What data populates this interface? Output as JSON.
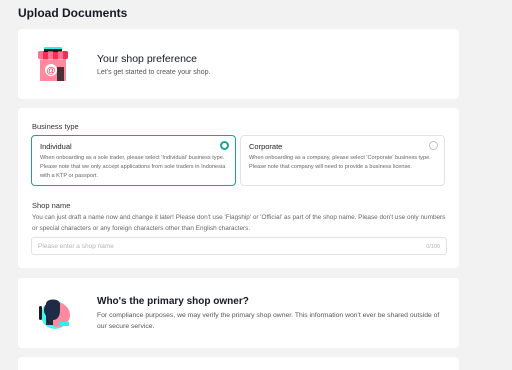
{
  "page": {
    "title": "Upload Documents"
  },
  "shop_preference": {
    "title": "Your shop preference",
    "subtitle": "Let's get started to create your shop."
  },
  "business_type": {
    "label": "Business type",
    "options": [
      {
        "title": "Individual",
        "description": "When onboarding as a sole trader, please select 'Individual' business type. Please note that we only accept applications from sole traders in Indonesia with a KTP or passport.",
        "selected": true
      },
      {
        "title": "Corporate",
        "description": "When onboarding as a company, please select 'Corporate' business type. Please note that company will need to provide a business license.",
        "selected": false
      }
    ]
  },
  "shop_name": {
    "label": "Shop name",
    "help": "You can just draft a name now and change it later! Please don't use 'Flagship' or 'Official' as part of the shop name. Please don't use only numbers or special characters or any foreign characters other than English characters.",
    "placeholder": "Please enter a shop name",
    "value": "",
    "counter": "0/100"
  },
  "primary_owner": {
    "title": "Who's the primary shop owner?",
    "description": "For compliance purposes, we may verify the primary shop owner. This information won't ever be shared outside of our secure service."
  },
  "colors": {
    "accent": "#1aa39a",
    "page_bg": "#f2f2f2",
    "card_bg": "#ffffff",
    "illustration_pink": "#fe2c55",
    "illustration_cyan": "#25f4ee"
  },
  "icons": {
    "shop_preference": "shop-storefront-icon",
    "primary_owner": "person-profile-icon"
  }
}
